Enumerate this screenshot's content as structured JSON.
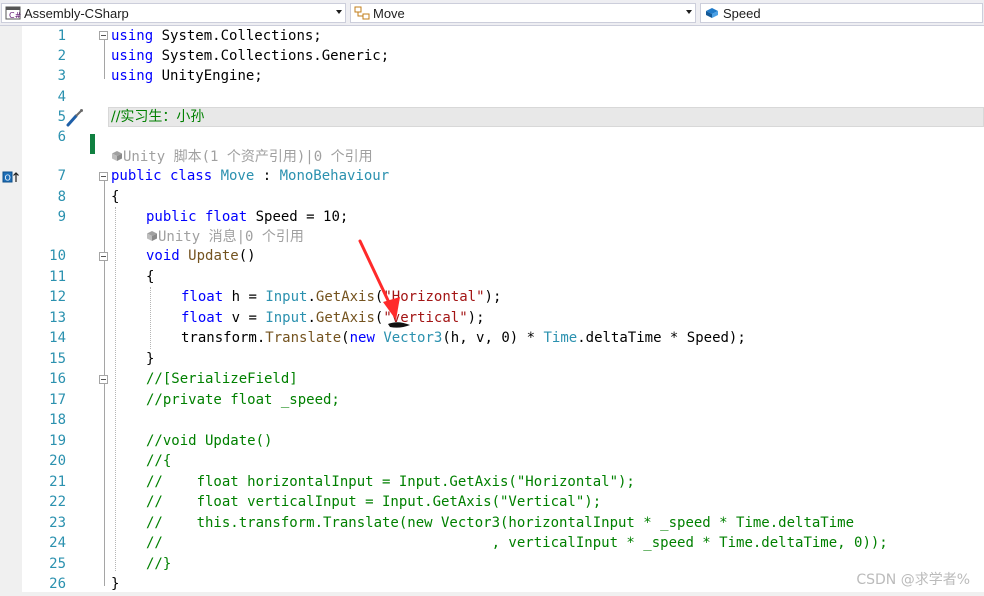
{
  "nav": {
    "project": "Assembly-CSharp",
    "type": "Move",
    "member": "Speed"
  },
  "line_numbers": [
    "1",
    "2",
    "3",
    "4",
    "5",
    "6",
    "7",
    "8",
    "9",
    "10",
    "11",
    "12",
    "13",
    "14",
    "15",
    "16",
    "17",
    "18",
    "19",
    "20",
    "21",
    "22",
    "23",
    "24",
    "25",
    "26"
  ],
  "code": {
    "l1_kw": "using",
    "l1_rest": " System.Collections;",
    "l2_kw": "using",
    "l2_rest": " System.Collections.Generic;",
    "l3_kw": "using",
    "l3_rest": " UnityEngine;",
    "l5_comment": "//实习生：小孙",
    "l7_kw": "public class ",
    "l7_type": "Move",
    "l7_colon": " : ",
    "l7_base": "MonoBehaviour",
    "l8": "{",
    "l9_kw": "public float",
    "l9_rest": " Speed = 10;",
    "l10_kw": "void",
    "l10_sp": " ",
    "l10_name": "Update",
    "l10_rest": "()",
    "l11": "{",
    "l12_kw": "float",
    "l12_a": " h = ",
    "l12_type": "Input",
    "l12_dot": ".",
    "l12_method": "GetAxis",
    "l12_paren": "(",
    "l12_str": "\"Horizontal\"",
    "l12_end": ");",
    "l13_kw": "float",
    "l13_a": " v = ",
    "l13_type": "Input",
    "l13_dot": ".",
    "l13_method": "GetAxis",
    "l13_paren": "(",
    "l13_str": "\"vertical\"",
    "l13_end": ");",
    "l14_a": "transform.",
    "l14_method": "Translate",
    "l14_paren": "(",
    "l14_kw": "new",
    "l14_sp": " ",
    "l14_type": "Vector3",
    "l14_args": "(h, v, 0) * ",
    "l14_type2": "Time",
    "l14_b": ".deltaTime * Speed);",
    "l15": "}",
    "l16_comment": "//[SerializeField]",
    "l17_comment": "//private float _speed;",
    "l19_comment": "//void Update()",
    "l20_comment": "//{",
    "l21_comment": "//    float horizontalInput = Input.GetAxis(\"Horizontal\");",
    "l22_comment": "//    float verticalInput = Input.GetAxis(\"Vertical\");",
    "l23_comment": "//    this.transform.Translate(new Vector3(horizontalInput * _speed * Time.deltaTime",
    "l24_comment": "//                                       , verticalInput * _speed * Time.deltaTime, 0));",
    "l25_comment": "//}",
    "l26": "}"
  },
  "codelens": {
    "class_hint": "Unity 脚本(1 个资产引用)|0 个引用",
    "method_hint": "Unity 消息|0 个引用"
  },
  "glyphs": {
    "line5": "quick-actions-screwdriver-icon",
    "line7": "implements-override-marker-icon"
  },
  "annotation": {
    "color": "#ff2a2a",
    "target": "vertical string argument"
  },
  "colors": {
    "keyword": "#0000ff",
    "type": "#2b91af",
    "string": "#a31515",
    "comment": "#008000",
    "line_number": "#2b91af",
    "change_bar": "#108040"
  },
  "watermark": "CSDN @求学者%"
}
